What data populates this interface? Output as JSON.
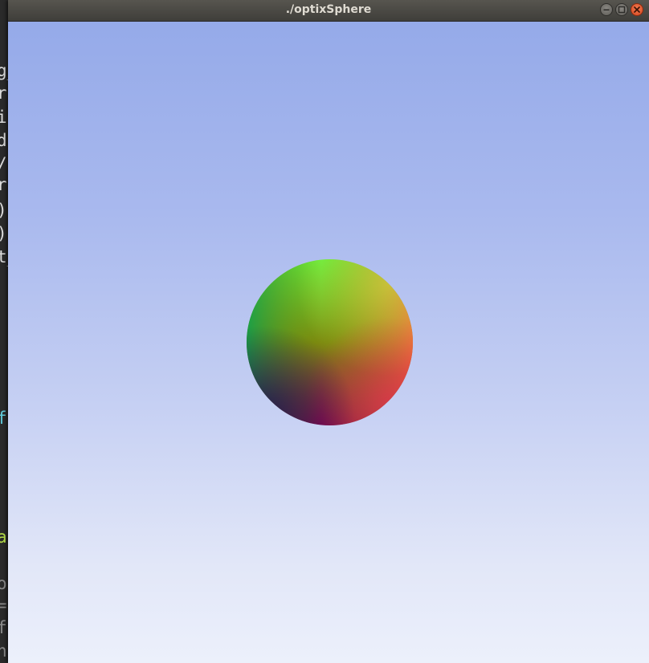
{
  "window": {
    "title": "./optixSphere"
  },
  "colors": {
    "titlebar": "#4a4945",
    "close_button": "#e45a2c",
    "sky_top": "#95aae9",
    "sky_bottom": "#ecf0fb",
    "sphere_top": "#60e840",
    "sphere_left": "#10a050",
    "sphere_right": "#ff6048",
    "sphere_bottom": "#90004a"
  },
  "background_terminal": {
    "fragments": [
      {
        "text": "g_",
        "color": "#dcdcdc"
      },
      {
        "text": "r",
        "color": "#dcdcdc"
      },
      {
        "text": "ia",
        "color": "#dcdcdc"
      },
      {
        "text": "do",
        "color": "#dcdcdc"
      },
      {
        "text": "/",
        "color": "#dcdcdc"
      },
      {
        "text": "r",
        "color": "#dcdcdc"
      },
      {
        "text": ")",
        "color": "#dcdcdc"
      },
      {
        "text": ")",
        "color": "#dcdcdc"
      },
      {
        "text": "t_",
        "color": "#dcdcdc"
      },
      {
        "text": "f",
        "color": "#5fc8d8"
      },
      {
        "text": "a",
        "color": "#b8e04a"
      },
      {
        "text": "o",
        "color": "#8a8a8a"
      },
      {
        "text": "=",
        "color": "#8a8a8a"
      },
      {
        "text": "f",
        "color": "#8a8a8a"
      },
      {
        "text": "n",
        "color": "#8a8a8a"
      }
    ]
  },
  "icons": {
    "minimize": "minimize-icon",
    "maximize": "maximize-icon",
    "close": "close-icon"
  }
}
